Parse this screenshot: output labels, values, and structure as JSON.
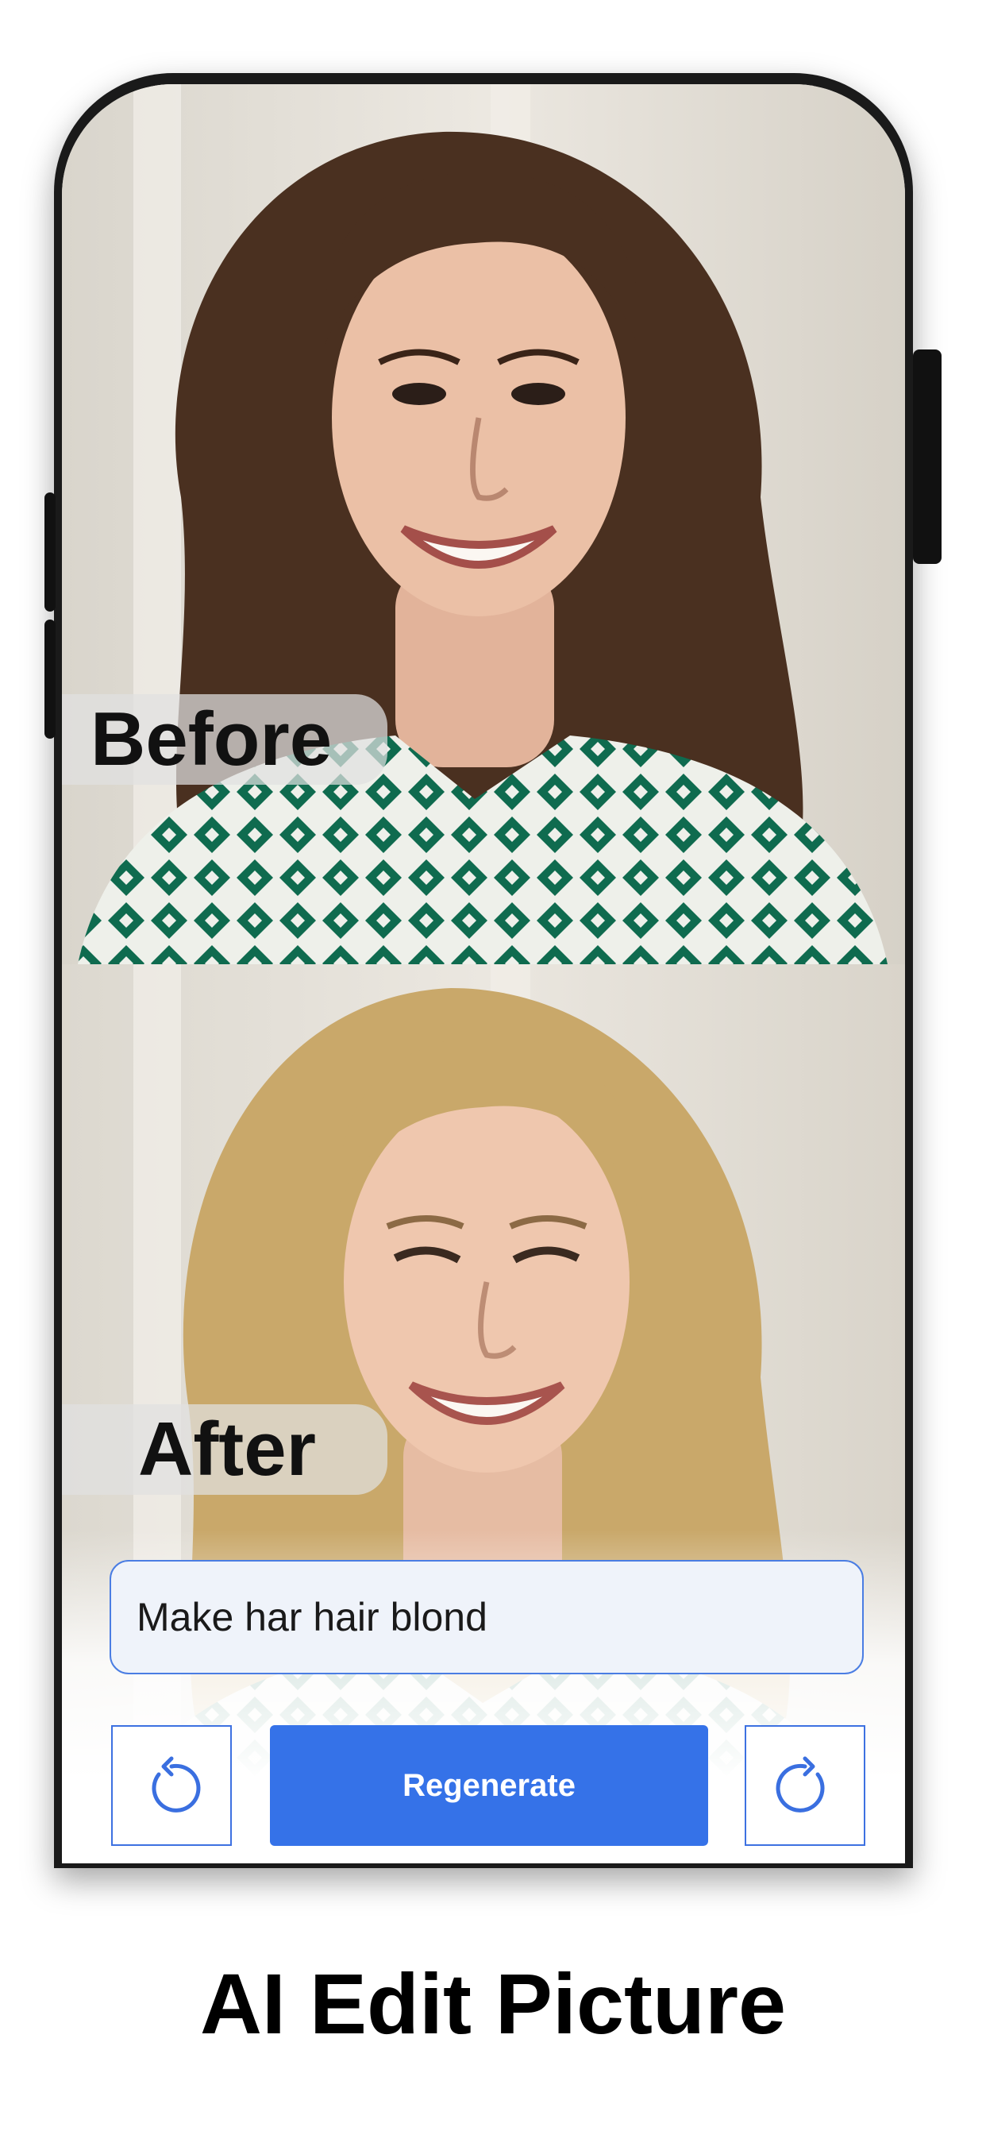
{
  "labels": {
    "before": "Before",
    "after": "After"
  },
  "prompt": {
    "value": "Make har hair blond"
  },
  "actions": {
    "undo_icon": "undo-icon",
    "redo_icon": "redo-icon",
    "regenerate_label": "Regenerate"
  },
  "caption": "AI Edit Picture",
  "colors": {
    "accent": "#3572e8",
    "input_border": "#4a7de3",
    "input_bg": "#eff3fa",
    "before_hair": "#4a3020",
    "after_hair": "#c9a86a",
    "shirt_green": "#0f6b4f"
  }
}
